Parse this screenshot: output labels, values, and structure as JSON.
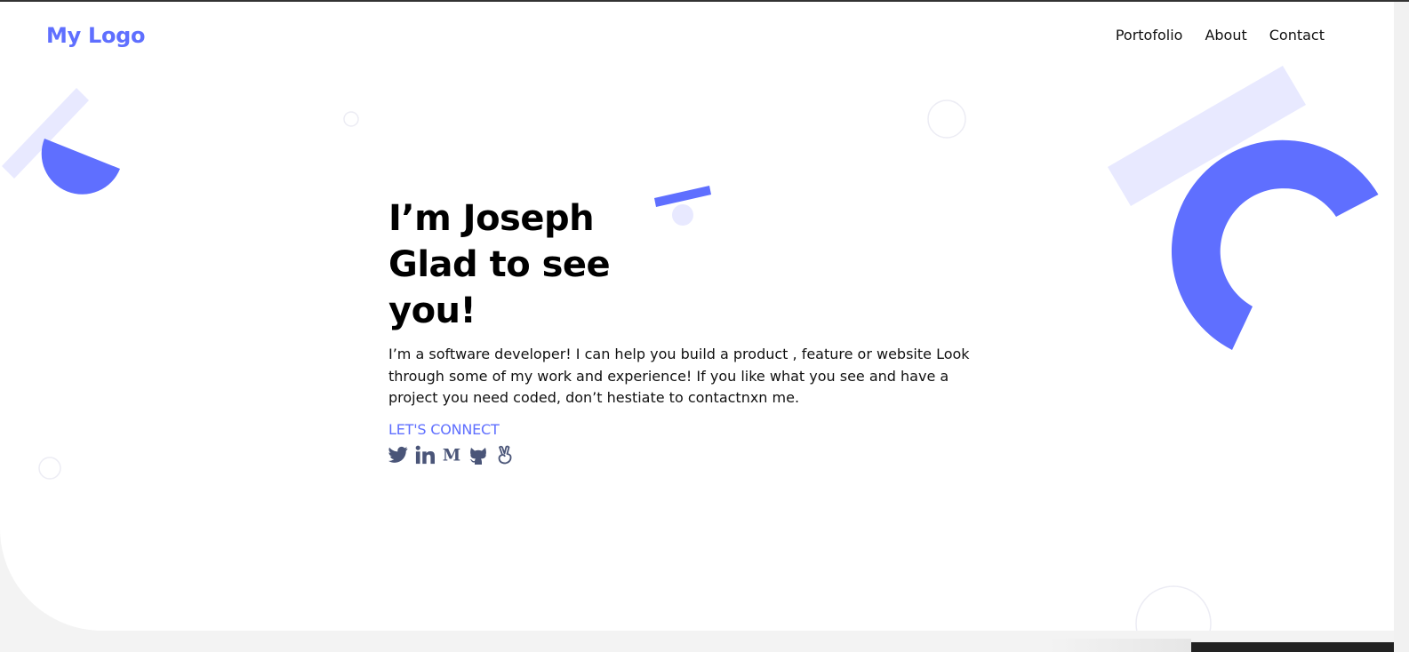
{
  "header": {
    "logo": "My Logo",
    "nav": [
      "Portofolio",
      "About",
      "Contact"
    ]
  },
  "hero": {
    "headline_lines": [
      "I’m Joseph",
      "Glad to see",
      "you!"
    ],
    "description": "I’m a software developer! I can help you build a product , feature or website Look through some of my work and experience! If you like what you see and have a project you need coded, don’t hestiate to contactnxn me.",
    "connect_label": "LET'S CONNECT",
    "social_icons": [
      "twitter-icon",
      "linkedin-icon",
      "medium-icon",
      "github-icon",
      "angellist-icon"
    ]
  },
  "colors": {
    "accent": "#5f6fff",
    "accent_light": "#e8e9ff",
    "icon": "#4a5578",
    "text": "#111111"
  }
}
